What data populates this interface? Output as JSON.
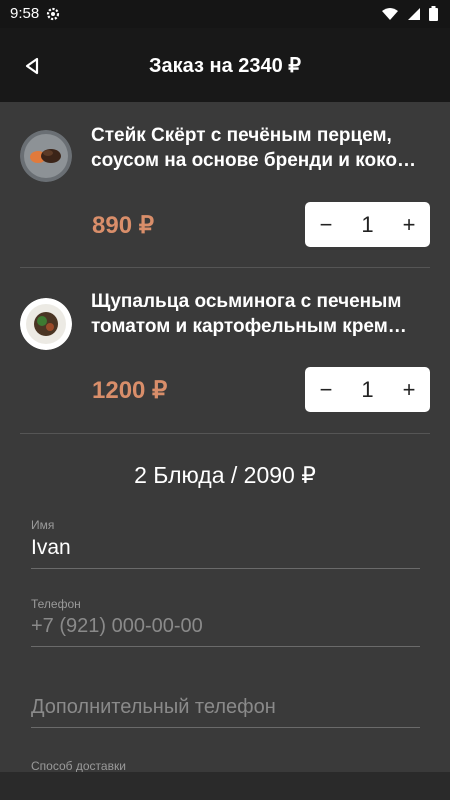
{
  "status": {
    "time": "9:58"
  },
  "header": {
    "title": "Заказ на 2340 ₽"
  },
  "items": [
    {
      "name": "Стейк Скёрт с печёным перцем, соусом на основе бренди и коко…",
      "price": "890 ₽",
      "minus": "−",
      "quantity": "1",
      "plus": "+"
    },
    {
      "name": "Щупальца осьминога с печеным томатом и картофельным крем…",
      "price": "1200 ₽",
      "minus": "−",
      "quantity": "1",
      "plus": "+"
    }
  ],
  "summary": "2 Блюда / 2090 ₽",
  "form": {
    "name_label": "Имя",
    "name_value": "Ivan",
    "phone_label": "Телефон",
    "phone_placeholder": "+7 (921) 000-00-00",
    "extra_phone_placeholder": "Дополнительный телефон",
    "delivery_label": "Способ доставки"
  },
  "colors": {
    "accent_price": "#d98e6a",
    "background": "#3a3a3a",
    "app_bar": "#181818"
  }
}
